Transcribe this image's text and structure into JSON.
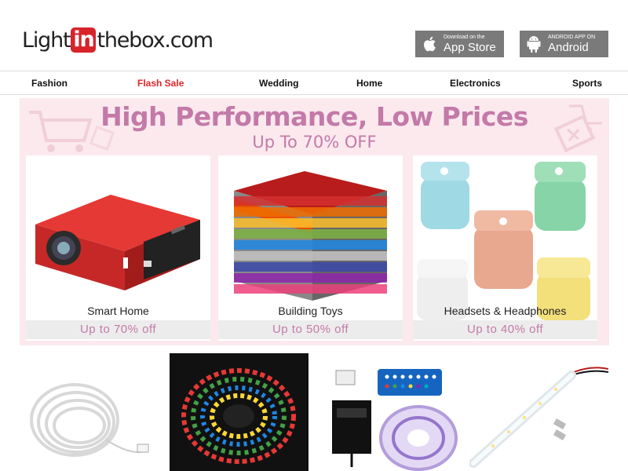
{
  "header": {
    "logo_pre": "Light",
    "logo_in": "in",
    "logo_post": "thebox.com",
    "appstore_small": "Download on the",
    "appstore_big": "App Store",
    "android_small": "ANDROID APP ON",
    "android_big": "Android"
  },
  "nav": {
    "items": [
      "Fashion",
      "Flash Sale",
      "Wedding",
      "Home",
      "Electronics",
      "Sports"
    ]
  },
  "banner": {
    "title": "High Performance, Low Prices",
    "subtitle": "Up To 70% OFF",
    "cards": [
      {
        "name": "Smart Home",
        "offer": "Up to 70% off"
      },
      {
        "name": "Building Toys",
        "offer": "Up to 50% off"
      },
      {
        "name": "Headsets & Headphones",
        "offer": "Up to 40% off"
      }
    ]
  },
  "colors": {
    "accent": "#e0262b",
    "banner_bg": "#fbe9ee",
    "banner_text": "#c37aa8"
  }
}
